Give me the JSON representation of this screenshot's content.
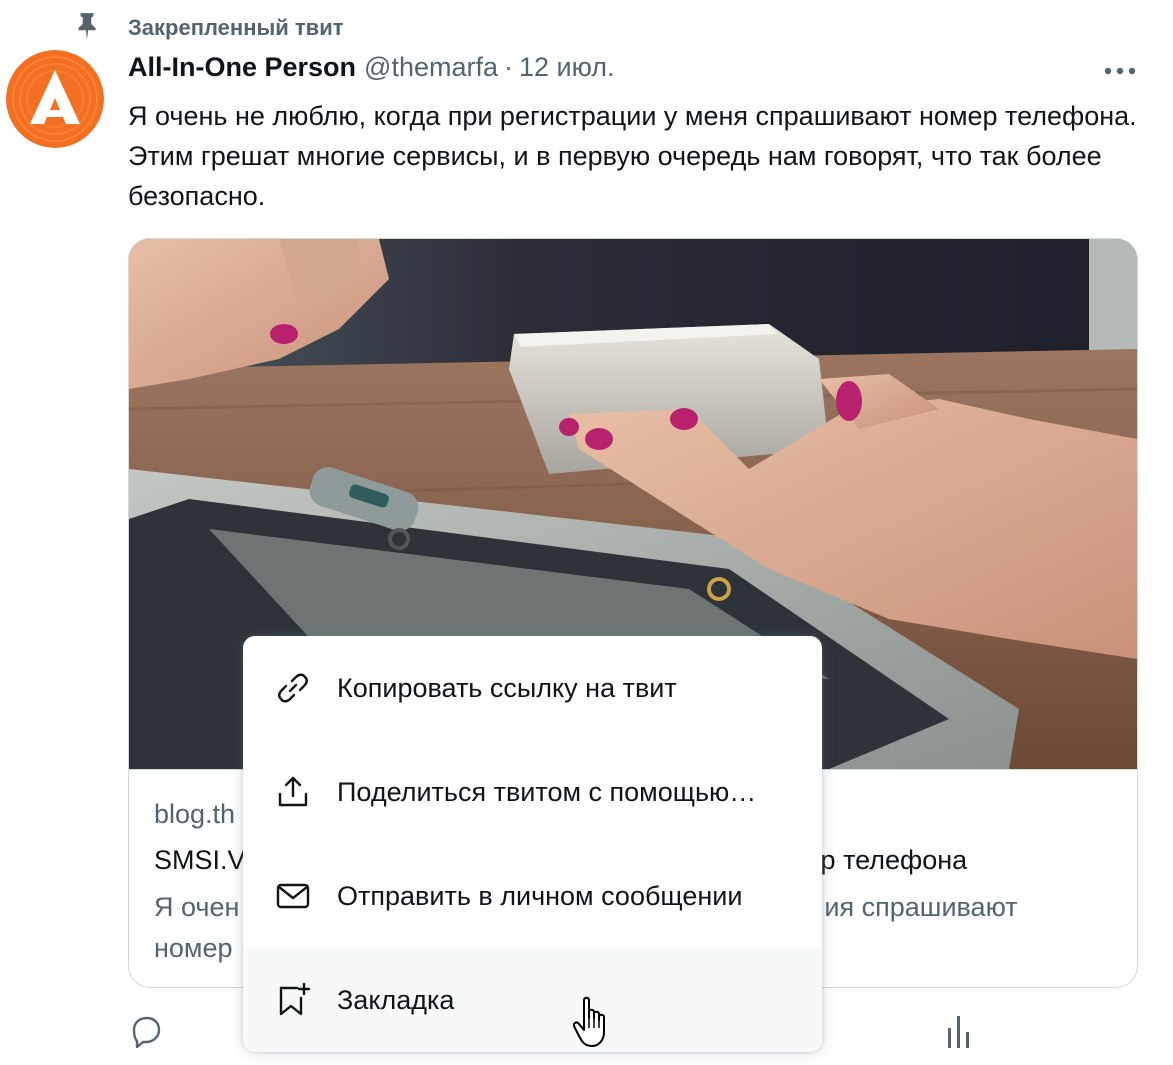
{
  "pinned": {
    "label": "Закрепленный твит",
    "icon": "pin-icon"
  },
  "tweet": {
    "display_name": "All-In-One Person",
    "handle": "@themarfa",
    "separator": "·",
    "date": "12 июл.",
    "text": "Я очень не люблю, когда при регистрации у меня спрашивают номер телефона. Этим грешат многие сервисы, и в первую очередь нам говорят, что так более безопасно.",
    "avatar_colors": {
      "ring": "#f36f21",
      "logo": "#ffffff"
    }
  },
  "card": {
    "domain": "blog.th",
    "title_left": "SMSI.V",
    "title_right": "ер телефона",
    "desc_line1_left": "Я очен",
    "desc_line1_right": "ия спрашивают",
    "desc_line2_left": "номер"
  },
  "menu": {
    "items": [
      {
        "label": "Копировать ссылку на твит",
        "icon": "link-icon"
      },
      {
        "label": "Поделиться твитом с помощью…",
        "icon": "share-icon"
      },
      {
        "label": "Отправить в личном сообщении",
        "icon": "envelope-icon"
      },
      {
        "label": "Закладка",
        "icon": "bookmark-add-icon"
      }
    ]
  },
  "colors": {
    "text": "#0f1419",
    "secondary": "#536471",
    "border": "#cfd9de",
    "hover": "#f7f9f9"
  }
}
